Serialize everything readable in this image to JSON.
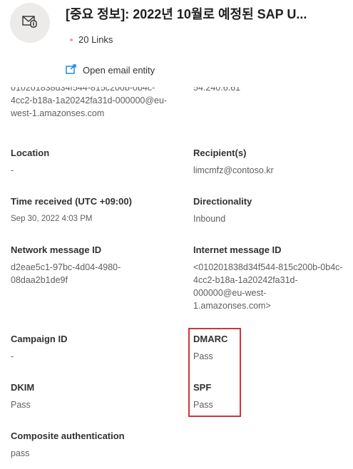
{
  "header": {
    "subject": "[중요 정보]: 2022년 10월로 예정된 SAP U...",
    "links_count": "20 Links",
    "open_email_label": "Open email entity",
    "accent_color": "#0078d4"
  },
  "details": {
    "sender_cut": "010201838d34f544-815c200b-0b4c-4cc2-b18a-1a20242fa31d-000000@eu-west-1.amazonses.com",
    "ip_cut": "54.240.6.61",
    "location_label": "Location",
    "location_value": "-",
    "recipients_label": "Recipient(s)",
    "recipients_value": "limcmfz@contoso.kr",
    "time_label": "Time received (UTC +09:00)",
    "time_value": "Sep 30, 2022 4:03 PM",
    "directionality_label": "Directionality",
    "directionality_value": "Inbound",
    "network_id_label": "Network message ID",
    "network_id_value": "d2eae5c1-97bc-4d04-4980-08daa2b1de9f",
    "internet_id_label": "Internet message ID",
    "internet_id_value": "<010201838d34f544-815c200b-0b4c-4cc2-b18a-1a20242fa31d-000000@eu-west-1.amazonses.com>",
    "campaign_label": "Campaign ID",
    "campaign_value": "-",
    "dmarc_label": "DMARC",
    "dmarc_value": "Pass",
    "dkim_label": "DKIM",
    "dkim_value": "Pass",
    "spf_label": "SPF",
    "spf_value": "Pass",
    "composite_label": "Composite authentication",
    "composite_value": "pass",
    "highlight_color": "#d13438"
  }
}
